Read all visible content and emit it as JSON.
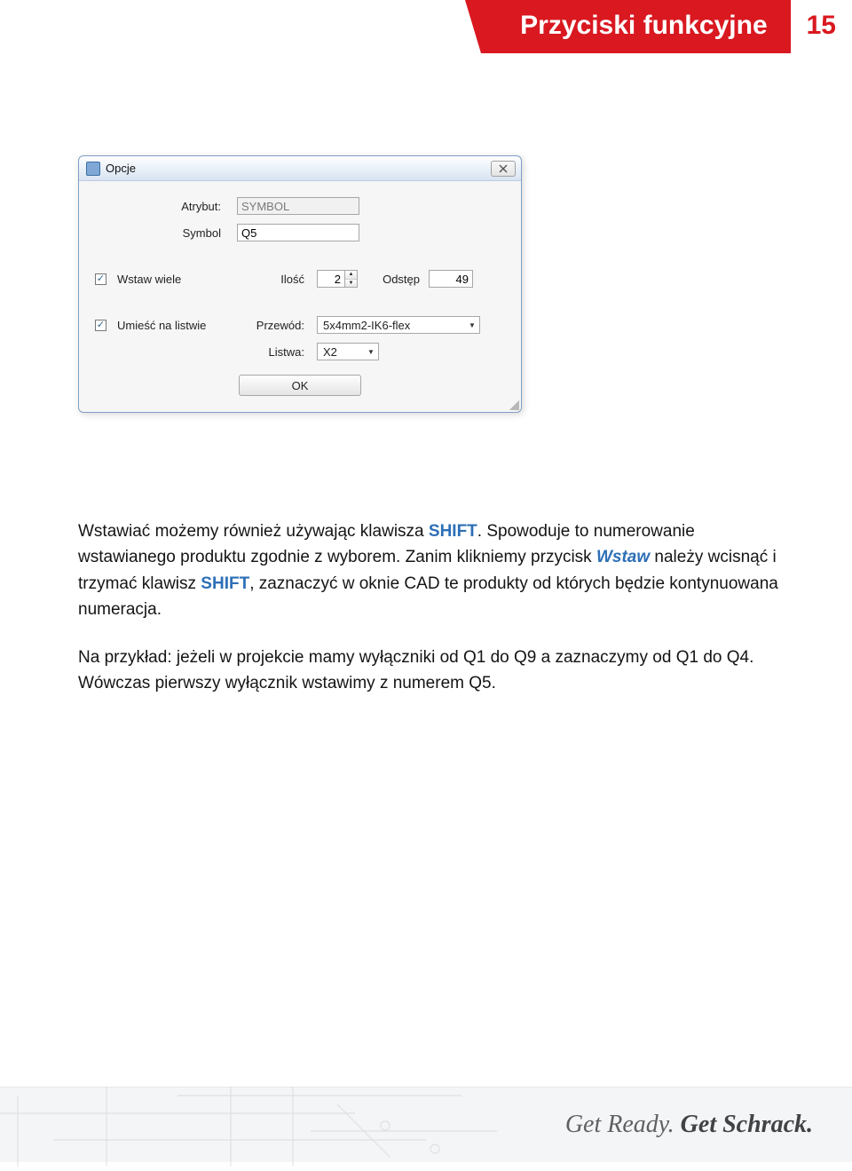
{
  "header": {
    "title": "Przyciski funkcyjne",
    "page_num": "15"
  },
  "dialog": {
    "title": "Opcje",
    "atrybut_label": "Atrybut:",
    "atrybut_value": "SYMBOL",
    "symbol_label": "Symbol",
    "symbol_value": "Q5",
    "wstaw_wiele_label": "Wstaw wiele",
    "wstaw_wiele_checked": true,
    "ilosc_label": "Ilość",
    "ilosc_value": "2",
    "odstep_label": "Odstęp",
    "odstep_value": "49",
    "umiesc_label": "Umieść na listwie",
    "umiesc_checked": true,
    "przewod_label": "Przewód:",
    "przewod_value": "5x4mm2-IK6-flex",
    "listwa_label": "Listwa:",
    "listwa_value": "X2",
    "ok_label": "OK"
  },
  "body": {
    "p1a": "Wstawiać możemy również używając klawisza ",
    "p1_shift": "SHIFT",
    "p1b": ". Spowoduje to numerowanie wstawianego produktu zgodnie z wyborem. Zanim klikniemy przycisk ",
    "p1_wstaw": "Wstaw",
    "p1c": " należy wcisnąć i trzymać klawisz ",
    "p1_shift2": "SHIFT",
    "p1d": ", zaznaczyć w oknie CAD te produkty od których będzie kontynuowana numeracja.",
    "p2": "Na przykład: jeżeli w projekcie mamy wyłączniki od Q1 do Q9 a zaznaczymy od Q1 do Q4. Wówczas pierwszy wyłącznik wstawimy z numerem Q5."
  },
  "footer": {
    "part1": "Get Ready. ",
    "part2": "Get Schrack."
  }
}
